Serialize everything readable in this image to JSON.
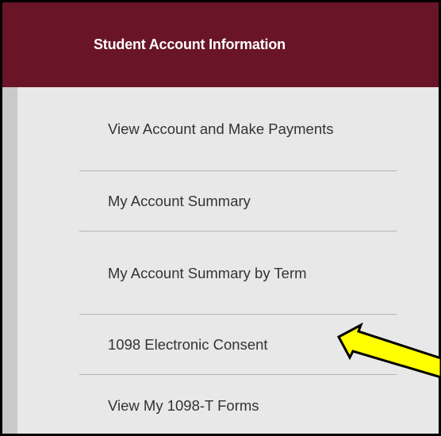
{
  "panel": {
    "title": "Student Account Information"
  },
  "menu": {
    "items": [
      {
        "label": "View Account and Make Payments"
      },
      {
        "label": "My Account Summary"
      },
      {
        "label": "My Account Summary by Term"
      },
      {
        "label": "1098 Electronic Consent",
        "highlighted": true
      },
      {
        "label": "View My 1098-T Forms"
      }
    ]
  },
  "annotation": {
    "icon": "arrow-pointer-icon",
    "fill_color": "#ffff00",
    "outline_color": "#000000"
  },
  "colors": {
    "header_background": "#6a1428",
    "panel_background": "#e8e8e8",
    "rail_background": "#c9c9c9"
  }
}
